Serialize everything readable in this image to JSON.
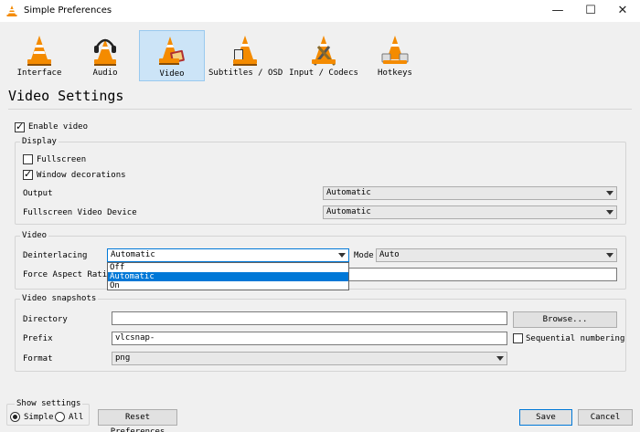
{
  "window": {
    "title": "Simple Preferences",
    "minimize_glyph": "—",
    "maximize_glyph": "☐",
    "close_glyph": "✕"
  },
  "toolbar": {
    "items": [
      {
        "label": "Interface",
        "icon": "vlc-cone-icon"
      },
      {
        "label": "Audio",
        "icon": "cone-headphones-icon"
      },
      {
        "label": "Video",
        "icon": "cone-film-icon",
        "selected": true
      },
      {
        "label": "Subtitles / OSD",
        "icon": "cone-subtitles-icon"
      },
      {
        "label": "Input / Codecs",
        "icon": "cone-tools-icon"
      },
      {
        "label": "Hotkeys",
        "icon": "cone-keys-icon"
      }
    ]
  },
  "heading": "Video Settings",
  "enable_video": {
    "label": "Enable video",
    "checked": true
  },
  "display": {
    "group_label": "Display",
    "fullscreen": {
      "label": "Fullscreen",
      "checked": false
    },
    "window_decorations": {
      "label": "Window decorations",
      "checked": true
    },
    "output": {
      "label": "Output",
      "value": "Automatic"
    },
    "fullscreen_device": {
      "label": "Fullscreen Video Device",
      "value": "Automatic"
    }
  },
  "video": {
    "group_label": "Video",
    "deinterlacing": {
      "label": "Deinterlacing",
      "value": "Automatic",
      "options": [
        "Off",
        "Automatic",
        "On"
      ],
      "selected_index": 1
    },
    "mode": {
      "label": "Mode",
      "value": "Auto"
    },
    "force_aspect": {
      "label": "Force Aspect Ratio",
      "value": ""
    }
  },
  "snapshots": {
    "group_label": "Video snapshots",
    "directory": {
      "label": "Directory",
      "value": ""
    },
    "browse_label": "Browse...",
    "prefix": {
      "label": "Prefix",
      "value": "vlcsnap-"
    },
    "sequential": {
      "label": "Sequential numbering",
      "checked": false
    },
    "format": {
      "label": "Format",
      "value": "png"
    }
  },
  "show_settings": {
    "group_label": "Show settings",
    "simple_label": "Simple",
    "all_label": "All",
    "selected": "Simple"
  },
  "buttons": {
    "reset": "Reset Preferences",
    "save": "Save",
    "cancel": "Cancel"
  },
  "colors": {
    "accent": "#0078d7",
    "selected_tool_bg": "#cce4f7",
    "cone_orange": "#f48b00"
  }
}
